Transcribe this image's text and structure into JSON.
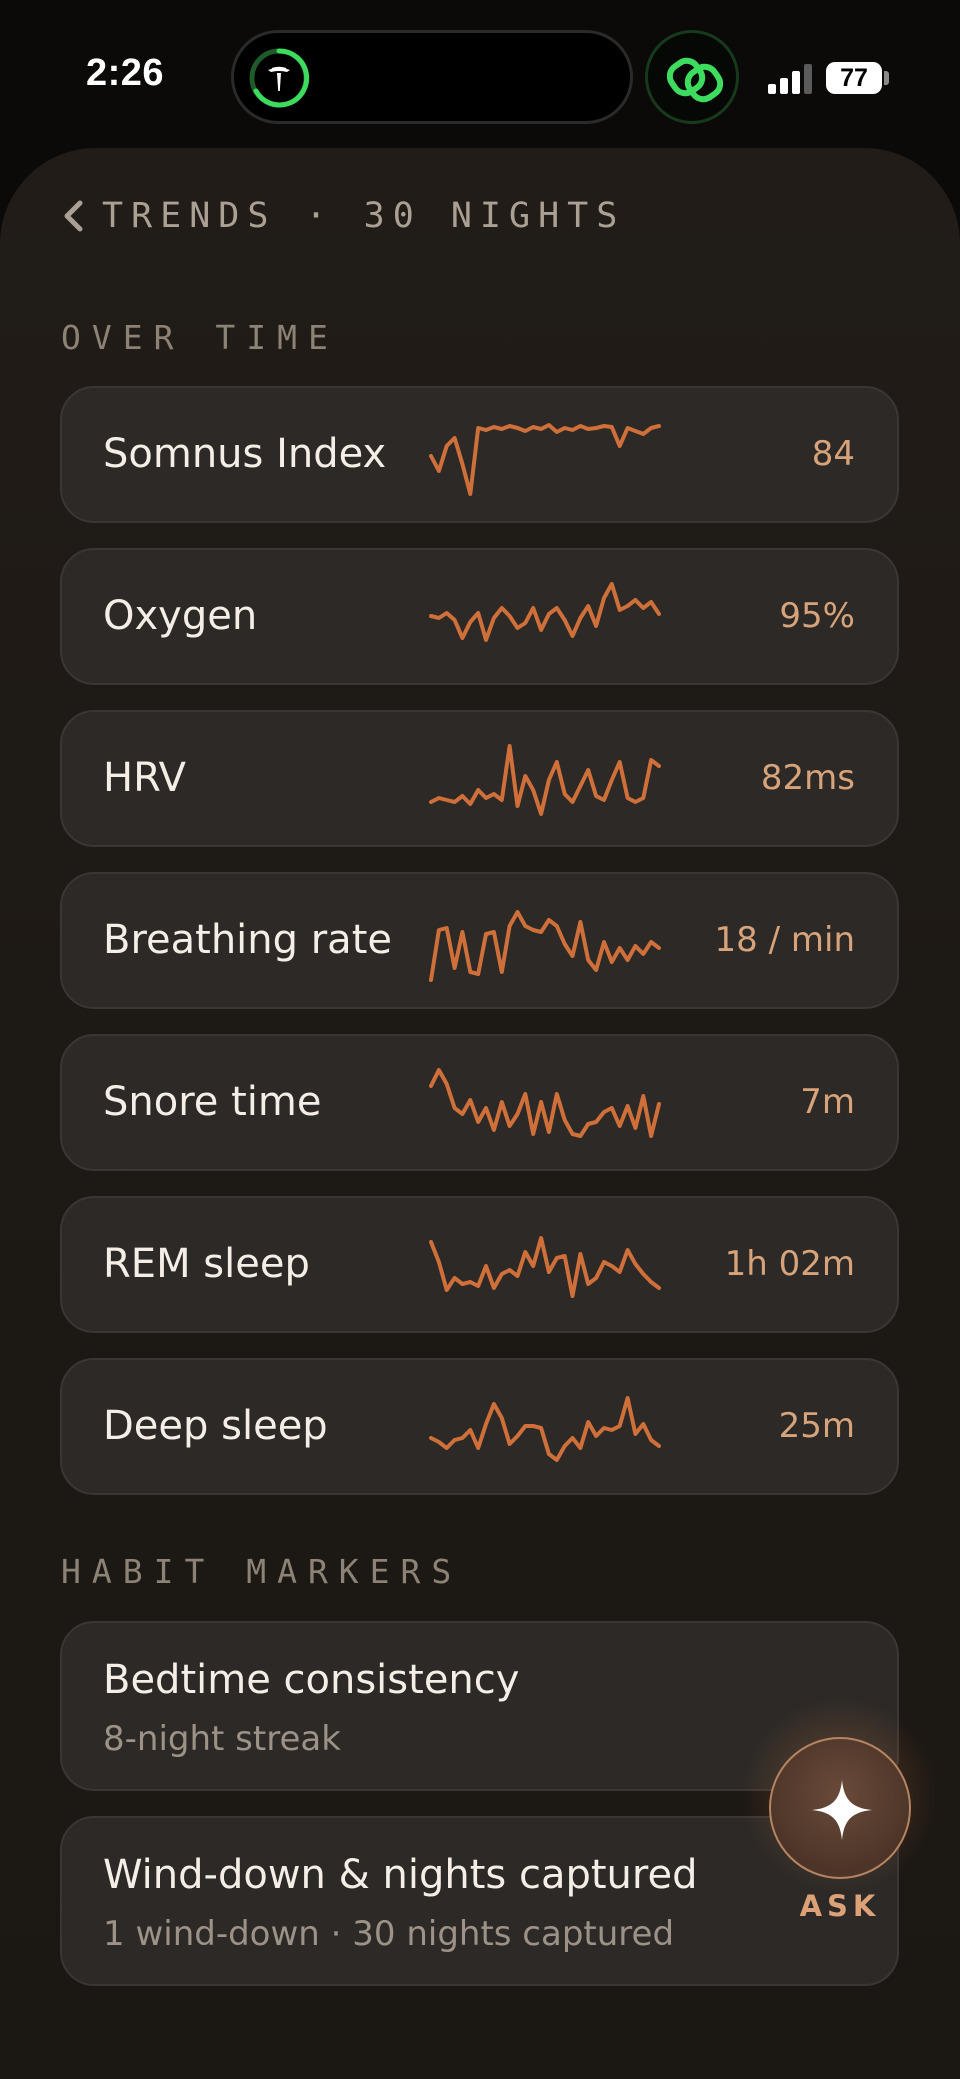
{
  "status_bar": {
    "time": "2:26",
    "battery": "77"
  },
  "header": {
    "back_label": "TRENDS · 30 NIGHTS"
  },
  "sections": {
    "over_time": "OVER TIME",
    "habit_markers": "HABIT MARKERS"
  },
  "metrics": [
    {
      "label": "Somnus Index",
      "value": "84",
      "trend": [
        40,
        55,
        30,
        22,
        48,
        78,
        12,
        14,
        11,
        13,
        10,
        12,
        15,
        11,
        13,
        9,
        16,
        12,
        14,
        10,
        13,
        12,
        10,
        11,
        30,
        12,
        15,
        18,
        12,
        10
      ]
    },
    {
      "label": "Oxygen",
      "value": "95%",
      "trend": [
        38,
        40,
        35,
        42,
        60,
        44,
        35,
        62,
        40,
        30,
        38,
        50,
        45,
        30,
        52,
        36,
        30,
        42,
        58,
        40,
        28,
        48,
        20,
        6,
        32,
        28,
        22,
        30,
        24,
        36
      ]
    },
    {
      "label": "HRV",
      "value": "82ms",
      "trend": [
        62,
        58,
        60,
        62,
        56,
        64,
        50,
        58,
        54,
        60,
        6,
        66,
        36,
        50,
        74,
        40,
        22,
        54,
        62,
        46,
        30,
        56,
        60,
        40,
        22,
        58,
        62,
        58,
        20,
        26
      ]
    },
    {
      "label": "Breathing rate",
      "value": "18 / min",
      "trend": [
        78,
        28,
        26,
        66,
        30,
        70,
        72,
        32,
        30,
        70,
        24,
        10,
        24,
        28,
        30,
        18,
        24,
        42,
        54,
        20,
        58,
        68,
        40,
        60,
        46,
        58,
        44,
        52,
        40,
        46
      ]
    },
    {
      "label": "Snore time",
      "value": "7m",
      "trend": [
        22,
        6,
        20,
        44,
        50,
        36,
        58,
        44,
        66,
        38,
        62,
        50,
        30,
        70,
        38,
        68,
        30,
        56,
        70,
        72,
        60,
        58,
        48,
        44,
        62,
        42,
        64,
        32,
        72,
        40
      ]
    },
    {
      "label": "REM sleep",
      "value": "1h 02m",
      "trend": [
        16,
        36,
        64,
        52,
        58,
        56,
        60,
        40,
        62,
        48,
        44,
        50,
        26,
        40,
        12,
        46,
        32,
        30,
        70,
        28,
        58,
        52,
        36,
        40,
        46,
        24,
        38,
        48,
        56,
        62
      ]
    },
    {
      "label": "Deep sleep",
      "value": "25m",
      "trend": [
        50,
        54,
        60,
        52,
        50,
        42,
        60,
        36,
        16,
        30,
        56,
        48,
        38,
        38,
        40,
        66,
        72,
        58,
        50,
        60,
        34,
        48,
        40,
        42,
        38,
        10,
        46,
        36,
        52,
        58
      ]
    }
  ],
  "habits": [
    {
      "title": "Bedtime consistency",
      "subtitle": "8-night streak"
    },
    {
      "title": "Wind-down & nights captured",
      "subtitle": "1 wind-down · 30 nights captured"
    }
  ],
  "ask": {
    "label": "ASK"
  },
  "colors": {
    "sparkline": "#cf6f3a",
    "accent_text": "#d7a37a",
    "link_green": "#3ddc5f"
  },
  "icons": {
    "tesla": "tesla-icon",
    "link": "linked-rings-icon",
    "back": "chevron-left-icon",
    "ask": "sparkle-icon"
  }
}
